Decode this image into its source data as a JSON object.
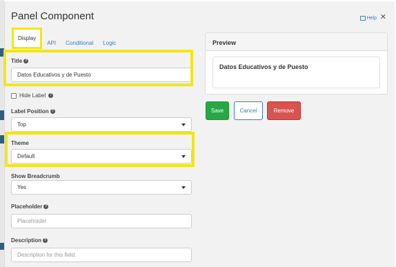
{
  "modal": {
    "title": "Panel Component",
    "help_label": "Help",
    "close_glyph": "✕"
  },
  "tabs": [
    {
      "label": "Display"
    },
    {
      "label": "API"
    },
    {
      "label": "Conditional"
    },
    {
      "label": "Logic"
    }
  ],
  "fields": {
    "title": {
      "label": "Title",
      "value": "Datos Educativos y de Puesto"
    },
    "hide_label": {
      "label": "Hide Label",
      "checked": false
    },
    "label_position": {
      "label": "Label Position",
      "value": "Top"
    },
    "theme": {
      "label": "Theme",
      "value": "Default"
    },
    "show_breadcrumb": {
      "label": "Show Breadcrumb",
      "value": "Yes"
    },
    "placeholder": {
      "label": "Placeholder",
      "placeholder": "Placeholder"
    },
    "description": {
      "label": "Description",
      "placeholder": "Description for this field."
    }
  },
  "preview": {
    "heading": "Preview",
    "panel_title": "Datos Educativos y de Puesto"
  },
  "actions": {
    "save": "Save",
    "cancel": "Cancel",
    "remove": "Remove"
  },
  "colors": {
    "highlight": "#f2e619",
    "link": "#3b7bbf",
    "save": "#28a745",
    "remove": "#d9534f"
  }
}
